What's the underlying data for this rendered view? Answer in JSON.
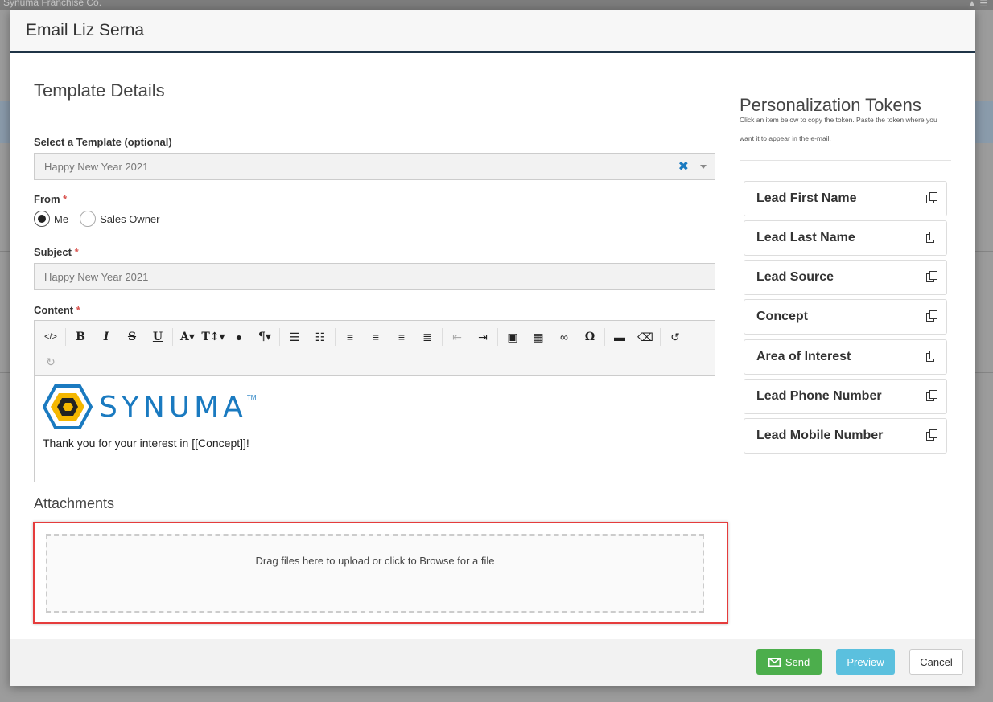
{
  "background_app": {
    "brand": "Synuma Franchise Co."
  },
  "modal": {
    "title": "Email Liz Serna",
    "template_details_title": "Template Details",
    "select_template": {
      "label": "Select a Template (optional)",
      "value": "Happy New Year 2021"
    },
    "from": {
      "label": "From",
      "options": [
        {
          "label": "Me",
          "checked": true
        },
        {
          "label": "Sales Owner",
          "checked": false
        }
      ]
    },
    "subject": {
      "label": "Subject",
      "value": "Happy New Year 2021"
    },
    "content": {
      "label": "Content",
      "logo_text": "SYNUMA",
      "logo_tm": "TM",
      "body_text": "Thank you for your interest in [[Concept]]!",
      "toolbar_icons": [
        "code-view-icon",
        "bold-icon",
        "italic-icon",
        "strikethrough-icon",
        "underline-icon",
        "font-family-icon",
        "font-size-icon",
        "color-icon",
        "paragraph-format-icon",
        "unordered-list-icon",
        "ordered-list-icon",
        "align-left-icon",
        "align-center-icon",
        "align-right-icon",
        "align-justify-icon",
        "outdent-icon",
        "indent-icon",
        "insert-image-icon",
        "insert-table-icon",
        "insert-link-icon",
        "special-characters-icon",
        "horizontal-line-icon",
        "clear-formatting-icon",
        "undo-icon",
        "redo-icon"
      ]
    },
    "attachments": {
      "title": "Attachments",
      "dropzone_text": "Drag files here to upload or click to Browse for a file"
    },
    "tokens": {
      "title": "Personalization Tokens",
      "help": "Click an item below to copy the token. Paste the token where you want it to appear in the e-mail.",
      "items": [
        {
          "label": "Lead First Name"
        },
        {
          "label": "Lead Last Name"
        },
        {
          "label": "Lead Source"
        },
        {
          "label": "Concept"
        },
        {
          "label": "Area of Interest"
        },
        {
          "label": "Lead Phone Number"
        },
        {
          "label": "Lead Mobile Number"
        }
      ]
    },
    "footer": {
      "send_label": "Send",
      "preview_label": "Preview",
      "cancel_label": "Cancel"
    }
  },
  "colors": {
    "send": "#4cae4c",
    "preview": "#5bc0de",
    "brand_blue": "#1a7ac0",
    "highlight_outline": "#e53c3c",
    "required": "#d9534f"
  }
}
